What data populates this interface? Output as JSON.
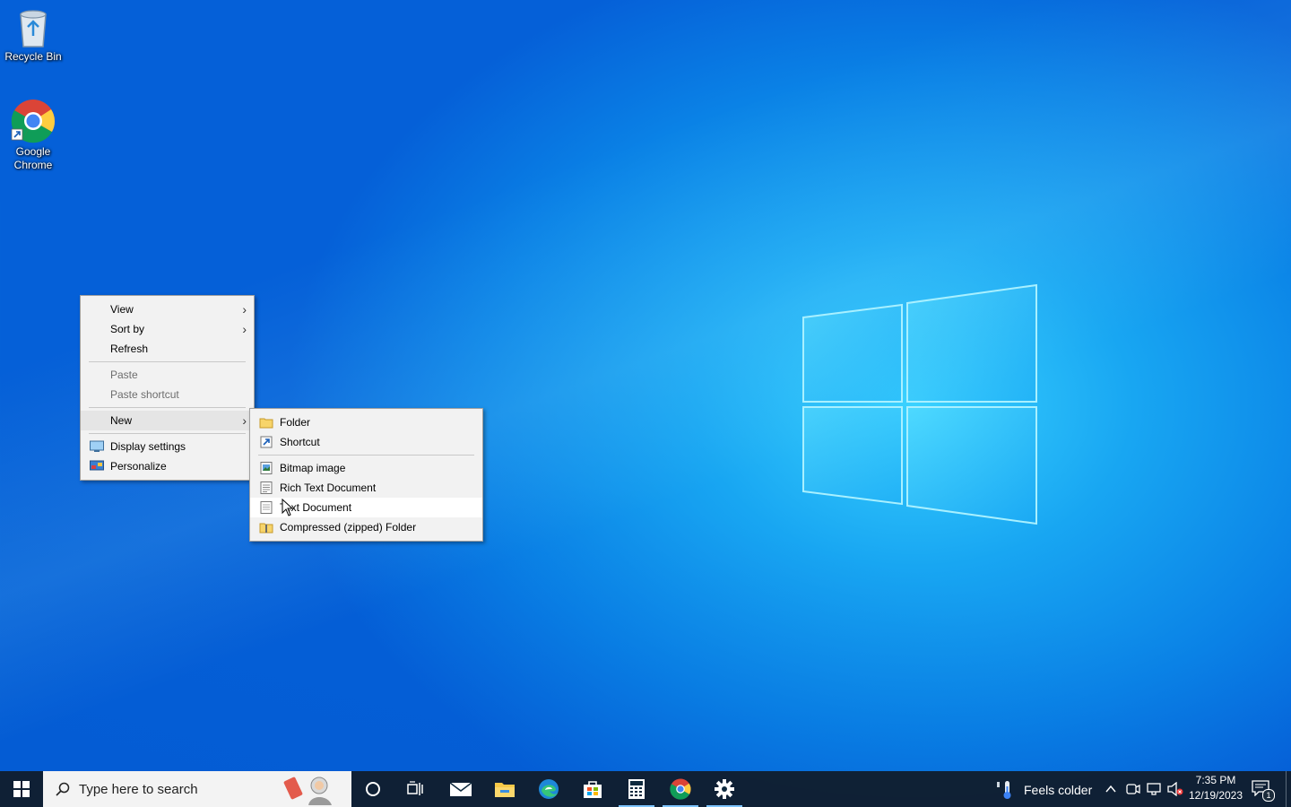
{
  "desktop": {
    "icons": [
      {
        "label": "Recycle Bin",
        "icon": "recycle-bin-icon"
      },
      {
        "label": "Google Chrome",
        "icon": "chrome-icon"
      }
    ]
  },
  "context_menu": {
    "items": {
      "view": "View",
      "sort_by": "Sort by",
      "refresh": "Refresh",
      "paste": "Paste",
      "paste_shortcut": "Paste shortcut",
      "new": "New",
      "display_settings": "Display settings",
      "personalize": "Personalize"
    }
  },
  "new_submenu": {
    "items": {
      "folder": "Folder",
      "shortcut": "Shortcut",
      "bitmap": "Bitmap image",
      "rich_text": "Rich Text Document",
      "text_doc": "Text Document",
      "zip_folder": "Compressed (zipped) Folder"
    },
    "hovered": "Text Document"
  },
  "taskbar": {
    "search_placeholder": "Type here to search",
    "pinned": [
      "start-icon",
      "cortana-icon",
      "task-view-icon",
      "mail-icon",
      "file-explorer-icon",
      "edge-icon",
      "store-icon",
      "calculator-icon",
      "chrome-icon",
      "settings-icon"
    ],
    "active": [
      "calculator-icon",
      "chrome-icon",
      "settings-icon"
    ],
    "weather_text": "Feels colder",
    "time": "7:35 PM",
    "date": "12/19/2023",
    "notification_count": "1"
  },
  "colors": {
    "accent": "#0a82e6",
    "taskbar": "#101e30",
    "menu_bg": "#f2f2f2"
  }
}
